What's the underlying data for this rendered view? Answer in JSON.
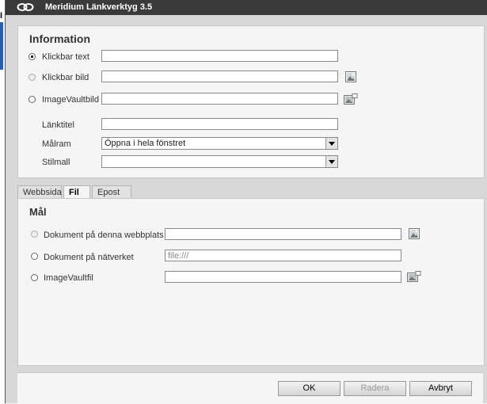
{
  "window": {
    "title": "Meridium Länkverktyg 3.5",
    "edge_glyph": "I"
  },
  "info": {
    "heading": "Information",
    "options": [
      {
        "label": "Klickbar text",
        "value": "",
        "checked": true
      },
      {
        "label": "Klickbar bild",
        "value": "",
        "checked": false
      },
      {
        "label": "ImageVaultbild",
        "value": "",
        "checked": false
      }
    ],
    "fields": {
      "lanktitel_label": "Länktitel",
      "lanktitel_value": "",
      "malram_label": "Målram",
      "malram_value": "Öppna i hela fönstret",
      "stilmall_label": "Stilmall",
      "stilmall_value": ""
    }
  },
  "tabs": [
    {
      "label": "Webbsida",
      "active": false
    },
    {
      "label": "Fil",
      "active": true
    },
    {
      "label": "Epost",
      "active": false
    }
  ],
  "mal": {
    "heading": "Mål",
    "options": [
      {
        "label": "Dokument på denna webbplats",
        "value": "",
        "placeholder": ""
      },
      {
        "label": "Dokument på nätverket",
        "value": "",
        "placeholder": "file:///"
      },
      {
        "label": "ImageVaultfil",
        "value": "",
        "placeholder": ""
      }
    ]
  },
  "buttons": {
    "ok": "OK",
    "radera": "Radera",
    "avbryt": "Avbryt"
  },
  "icons": {
    "logo": "chain-link-icon",
    "image_picker": "picture-icon",
    "imagevault_picker": "imagevault-icon"
  },
  "colors": {
    "titlebar": "#3a3a3a",
    "panel": "#f5f5f5",
    "window_bg": "#d8d8d8"
  }
}
